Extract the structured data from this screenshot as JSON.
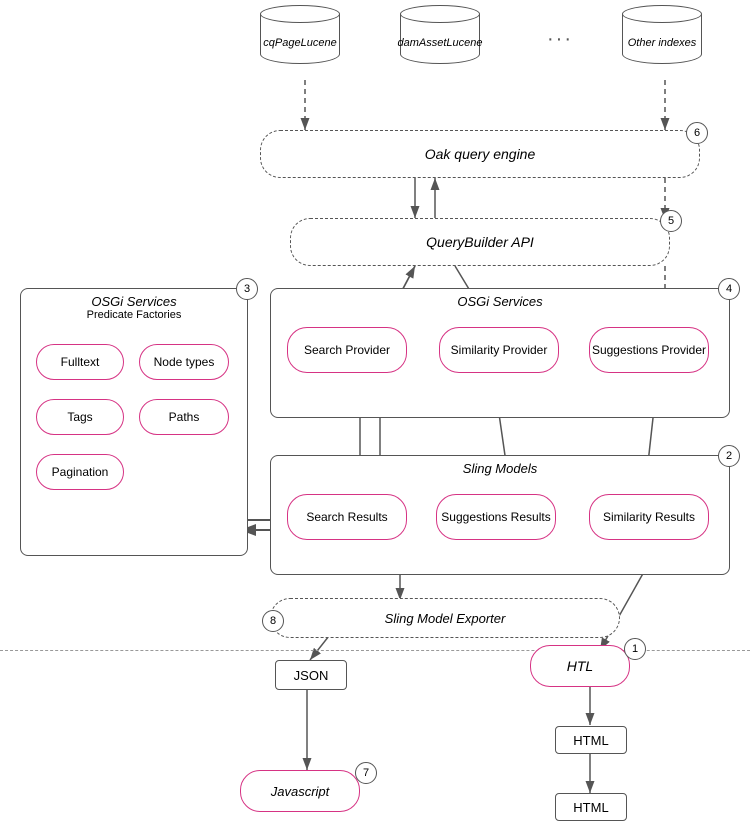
{
  "indexes": {
    "cqPage": "cqPageLucene",
    "damAsset": "damAssetLucene",
    "other": "Other indexes"
  },
  "boxes": {
    "oakQuery": "Oak query engine",
    "queryBuilder": "QueryBuilder API",
    "searchProvider": "Search Provider",
    "similarityProvider": "Similarity Provider",
    "suggestionsProvider": "Suggestions Provider",
    "searchResults": "Search Results",
    "suggestionsResults": "Suggestions Results",
    "similarityResults": "Similarity Results",
    "slingModelExporter": "Sling Model Exporter",
    "htl": "HTL",
    "json": "JSON",
    "html1": "HTML",
    "html2": "HTML",
    "javascript": "Javascript"
  },
  "containers": {
    "osgi1": {
      "title": "OSGi Services",
      "subtitle": "Predicate Factories"
    },
    "osgi2": "OSGi Services",
    "slingModels": "Sling Models"
  },
  "osgiItems": [
    "Fulltext",
    "Node types",
    "Tags",
    "Paths",
    "Pagination"
  ],
  "badges": [
    1,
    2,
    3,
    4,
    5,
    6,
    7,
    8
  ]
}
